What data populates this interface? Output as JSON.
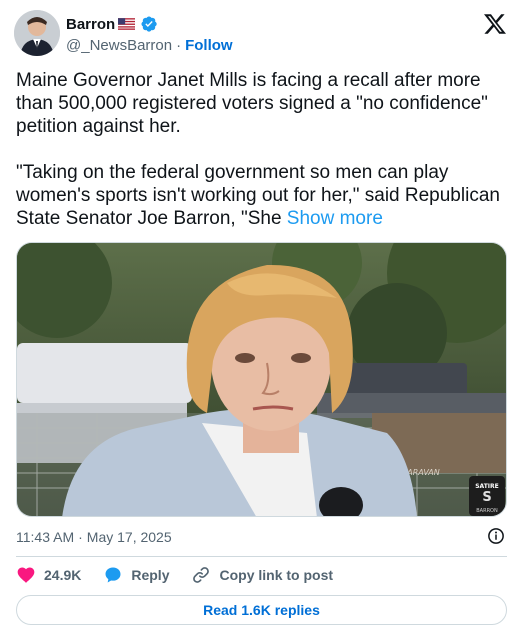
{
  "author": {
    "display_name": "Barron",
    "handle": "@_NewsBarron",
    "separator": "·",
    "follow_label": "Follow"
  },
  "tweet": {
    "text_paragraph_1": "Maine Governor Janet Mills is facing a recall after more than 500,000 registered voters signed a \"no confidence\" petition against her.",
    "text_paragraph_2": "\"Taking on the federal government so men can play women's sports isn't working out for her,\" said Republican State Senator Joe Barron, \"She ",
    "show_more_label": "Show more",
    "media_overlay_text": "KARAVAN",
    "media_badge_text_top": "SATIRE",
    "media_badge_text_bottom": "BARRON"
  },
  "meta": {
    "time": "11:43 AM",
    "separator": "·",
    "date": "May 17, 2025"
  },
  "actions": {
    "like_count": "24.9K",
    "reply_label": "Reply",
    "copy_link_label": "Copy link to post"
  },
  "replies_button_label": "Read 1.6K replies",
  "colors": {
    "accent_blue": "#1d9bf0",
    "link_blue": "#006fd6",
    "like_pink": "#f91880",
    "text_secondary": "#536471",
    "border": "#cfd9de"
  },
  "icons": {
    "x_logo": "x-logo-icon",
    "verified": "verified-badge-icon",
    "flag": "us-flag-icon",
    "info": "info-icon",
    "like": "heart-icon",
    "reply": "speech-bubble-icon",
    "copy_link": "link-icon"
  }
}
